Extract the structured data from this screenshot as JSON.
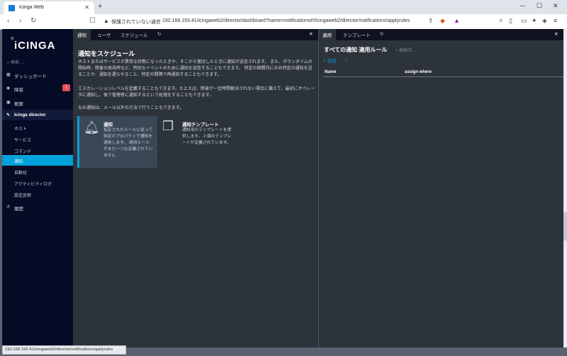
{
  "browser": {
    "tab_title": "Icinga Web",
    "security_label": "保護されていない通信",
    "url": "192.168.193.41/icingaweb2/director/dashboard?name=notifications#!/icingaweb2/director/notifications/applyrules",
    "status_url": "192.168.193.41/icingaweb2/director/notifications/applyrules"
  },
  "sidebar": {
    "logo": "iCINGA",
    "search_placeholder": "検索 ...",
    "items": [
      {
        "label": "ダッシュボード",
        "icon": "dashboard-icon"
      },
      {
        "label": "障害",
        "icon": "warning-icon",
        "badge": "1"
      },
      {
        "label": "概要",
        "icon": "overview-icon"
      },
      {
        "label": "Icinga director",
        "icon": "director-icon"
      }
    ],
    "sub_items": [
      "ホスト",
      "サービス",
      "コマンド",
      "通知",
      "自動化",
      "アクティビティログ",
      "設定反映"
    ],
    "history": "履歴"
  },
  "left": {
    "tabs": [
      "通知",
      "ユーザ",
      "スケジュール"
    ],
    "title": "通知をスケジュール",
    "para1": "ホストまたはサービスが異常な状態になったときや、そこから復旧したときに通知が送信されます。 また、ダウンタイムの開始時、障害の発見時など、特別なイベントのために通知を送信することもできます。 特定の期間内にのみ特定の通知を送ることや、通知を遅らせること、特定の間隔で再通知することもできます。",
    "para2": "エスカレーションレベルを定義することもできます。たとえば、障害が一定時間解決されない場合に備えて、最初にオペレータに通知し、後で管理者に通知するという処理をすることもできます。",
    "para3": "なお通知は、メール以外の方法で行うこともできます。",
    "cards": [
      {
        "title": "通知",
        "desc": "指定されたルールに従って特定のプロパティで通知を適用します。 適用ルールがまだ一つも定義されていません"
      },
      {
        "title": "通知テンプレート",
        "desc": "通知用のテンプレートを提供します。 2 個のテンプレートが定義されています。"
      }
    ]
  },
  "right": {
    "tabs": [
      "適用",
      "テンプレート"
    ],
    "title": "すべての通知 適用ルール",
    "search_placeholder": "検索中...",
    "add_label": "+ 追加",
    "columns": [
      "Name",
      "assign where"
    ]
  }
}
